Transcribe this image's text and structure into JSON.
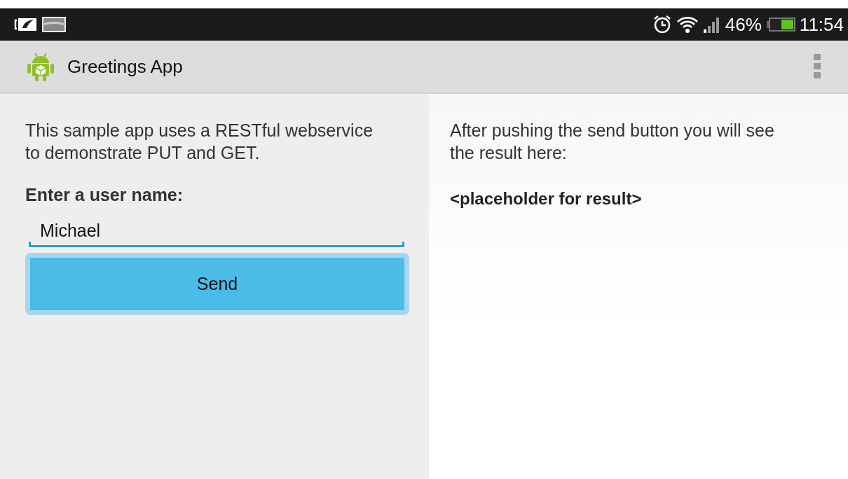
{
  "status_bar": {
    "battery_percent": "46%",
    "time": "11:54"
  },
  "action_bar": {
    "title": "Greetings App"
  },
  "left_panel": {
    "intro": "This sample app uses a RESTful webservice to demonstrate PUT and GET.",
    "field_label": "Enter a user name:",
    "field": {
      "value": "Michael"
    },
    "button": "Send"
  },
  "right_panel": {
    "hint": "After pushing the send button you will see the result here:",
    "result": "<placeholder for result>"
  }
}
